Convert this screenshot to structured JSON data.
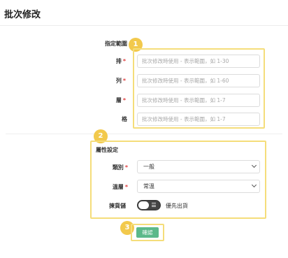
{
  "page": {
    "title": "批次修改"
  },
  "steps": {
    "one": "1",
    "two": "2",
    "three": "3"
  },
  "range_section": {
    "label": "指定範圍",
    "fields": [
      {
        "label": "排",
        "required": true,
        "placeholder": "批次修改時使用 - 表示範圍，如 1-30"
      },
      {
        "label": "列",
        "required": true,
        "placeholder": "批次修改時使用 - 表示範圍，如 1-60"
      },
      {
        "label": "層",
        "required": true,
        "placeholder": "批次修改時使用 - 表示範圍，如 1-7"
      },
      {
        "label": "格",
        "required": false,
        "placeholder": "批次修改時使用 - 表示範圍，如 1-7"
      }
    ]
  },
  "attr_section": {
    "label": "屬性設定",
    "category": {
      "label": "類別",
      "required": true,
      "value": "一般"
    },
    "temperature": {
      "label": "溫層",
      "required": true,
      "value": "常溫"
    },
    "pick_storage": {
      "label": "揀貨儲",
      "toggle_text": "優先出貨",
      "on": false
    }
  },
  "actions": {
    "confirm_label": "確認"
  },
  "required_mark": "*",
  "colors": {
    "highlight": "#f5dd7a",
    "badge": "#f2c94c",
    "confirm": "#5cb98a",
    "required": "#e04040"
  }
}
